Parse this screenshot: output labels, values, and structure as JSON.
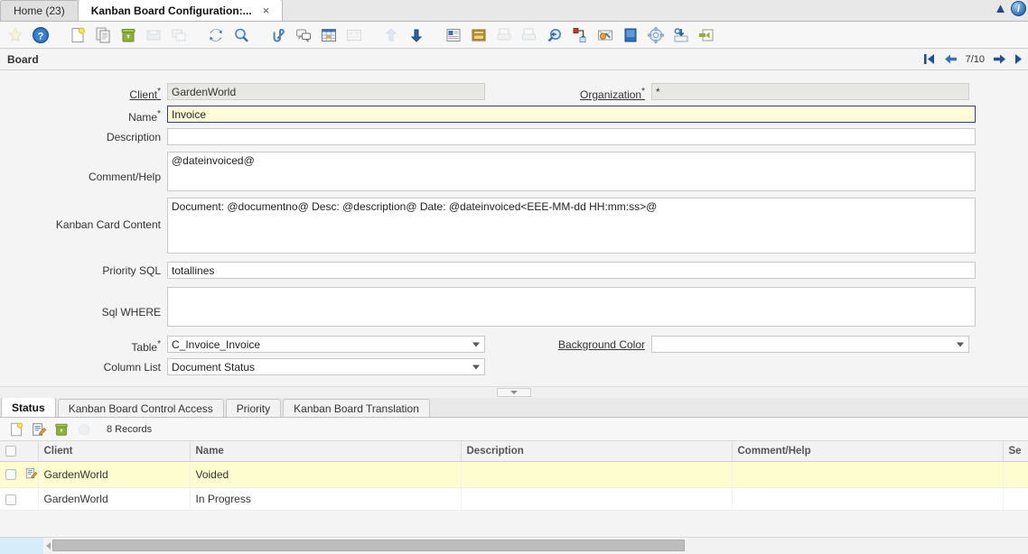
{
  "window": {
    "tabs": [
      {
        "label": "Home (23)",
        "active": false,
        "closable": false
      },
      {
        "label": "Kanban Board Configuration:...",
        "active": true,
        "closable": true,
        "close_label": "×"
      }
    ],
    "collapse_icon": "chevron-up-icon",
    "info_icon": "information-icon",
    "info_glyph": "i"
  },
  "toolbar": {
    "items": [
      {
        "name": "zoom-across-icon",
        "title": "Zoom Across",
        "dim": true
      },
      {
        "name": "help-icon",
        "title": "Help",
        "dim": false
      },
      {
        "name": "new-record-icon",
        "title": "New Record",
        "dim": false
      },
      {
        "name": "copy-record-icon",
        "title": "Copy Record",
        "dim": false
      },
      {
        "name": "delete-record-icon",
        "title": "Delete Record",
        "dim": false
      },
      {
        "name": "save-record-icon",
        "title": "Save Record",
        "dim": true
      },
      {
        "name": "undo-icon",
        "title": "Undo Changes",
        "dim": true
      },
      {
        "name": "refresh-icon",
        "title": "Refresh",
        "dim": false
      },
      {
        "name": "find-icon",
        "title": "Find Records",
        "dim": false
      },
      {
        "name": "attachment-icon",
        "title": "Attachment",
        "dim": false
      },
      {
        "name": "chat-icon",
        "title": "Chat / Comments",
        "dim": false
      },
      {
        "name": "grid-toggle-icon",
        "title": "Grid Toggle",
        "dim": false
      },
      {
        "name": "form-toggle-icon",
        "title": "Form Toggle",
        "dim": true
      },
      {
        "name": "parent-record-icon",
        "title": "Parent Record",
        "dim": true
      },
      {
        "name": "detail-record-icon",
        "title": "Detail Record",
        "dim": false
      },
      {
        "name": "report-icon",
        "title": "Report",
        "dim": false
      },
      {
        "name": "archive-icon",
        "title": "Archived Records",
        "dim": false
      },
      {
        "name": "print-icon",
        "title": "Print",
        "dim": true
      },
      {
        "name": "print-preview-icon",
        "title": "Print Preview",
        "dim": true
      },
      {
        "name": "zoom-window-icon",
        "title": "Zoom",
        "dim": false
      },
      {
        "name": "export-icon",
        "title": "Export",
        "dim": false
      },
      {
        "name": "email-icon",
        "title": "Send Mail",
        "dim": false
      },
      {
        "name": "product-info-icon",
        "title": "Product Info",
        "dim": false
      },
      {
        "name": "preference-icon",
        "title": "Preference",
        "dim": false
      },
      {
        "name": "request-icon",
        "title": "Requests",
        "dim": false
      },
      {
        "name": "exit-icon",
        "title": "Exit",
        "dim": false
      }
    ]
  },
  "nav": {
    "window_title": "Board",
    "first_label": "⏮",
    "prev_label": "←",
    "page_indicator": "7/10",
    "next_label": "→",
    "last_label": "▶"
  },
  "form": {
    "fields": {
      "client": {
        "label": "Client",
        "required": true,
        "is_link": true,
        "value": "GardenWorld",
        "readonly": true
      },
      "organization": {
        "label": "Organization",
        "required": true,
        "is_link": true,
        "value": "*",
        "readonly": true
      },
      "name": {
        "label": "Name",
        "required": true,
        "value": "Invoice",
        "focused": true
      },
      "description": {
        "label": "Description",
        "required": false,
        "value": ""
      },
      "comment_help": {
        "label": "Comment/Help",
        "required": false,
        "value": "@dateinvoiced@"
      },
      "kanban_card_content": {
        "label": "Kanban Card Content",
        "required": false,
        "value": "Document: @documentno@ Desc: @description@ Date: @dateinvoiced<EEE-MM-dd HH:mm:ss>@"
      },
      "priority_sql": {
        "label": "Priority SQL",
        "required": false,
        "value": "totallines"
      },
      "sql_where": {
        "label": "Sql WHERE",
        "required": false,
        "value": ""
      },
      "table": {
        "label": "Table",
        "required": true,
        "value": "C_Invoice_Invoice",
        "is_combo": true
      },
      "background_color": {
        "label": "Background Color",
        "required": false,
        "is_link": true,
        "value": "",
        "is_combo": true
      },
      "column_list": {
        "label": "Column List",
        "required": false,
        "value": "Document Status",
        "is_combo": true
      }
    }
  },
  "bottom_tabs": [
    {
      "label": "Status",
      "active": true
    },
    {
      "label": "Kanban Board Control Access",
      "active": false
    },
    {
      "label": "Priority",
      "active": false
    },
    {
      "label": "Kanban Board Translation",
      "active": false
    }
  ],
  "grid_toolbar": {
    "new_icon": "new-record-icon",
    "edit_icon": "edit-record-icon",
    "delete_icon": "delete-record-icon",
    "busy_icon": "loading-icon",
    "records_label": "8 Records"
  },
  "grid": {
    "columns": [
      "",
      "",
      "Client",
      "Name",
      "Description",
      "Comment/Help",
      "Se"
    ],
    "rows": [
      {
        "selected": true,
        "has_edit_icon": true,
        "client": "GardenWorld",
        "name": "Voided",
        "description": "",
        "comment_help": "",
        "seq": ""
      },
      {
        "selected": false,
        "has_edit_icon": false,
        "client": "GardenWorld",
        "name": "In Progress",
        "description": "",
        "comment_help": "",
        "seq": ""
      }
    ]
  },
  "scrollbar": {
    "left_arrow": "scroll-left-arrow"
  },
  "colors": {
    "accent_blue": "#1f4e9c",
    "focus_yellow": "#fdfdd8",
    "selected_row": "#fdfdd0",
    "readonly_gray": "#e7e7e3",
    "toolbar_bg": "#f7f7f7"
  }
}
